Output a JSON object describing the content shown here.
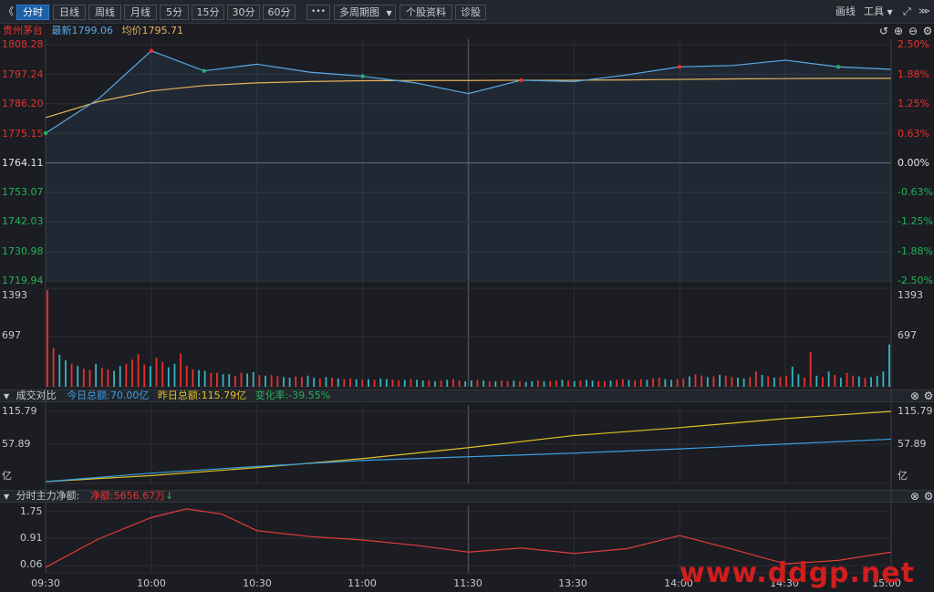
{
  "toolbar": {
    "collapse": "《",
    "periods": [
      "分时",
      "日线",
      "周线",
      "月线",
      "5分",
      "15分",
      "30分",
      "60分"
    ],
    "more": "•••",
    "multi_period": "多周期图",
    "stock_info": "个股资料",
    "diagnose": "诊股",
    "draw_line": "画线",
    "tools": "工具"
  },
  "stock": {
    "name": "贵州茅台",
    "latest_label": "最新",
    "latest": "1799.06",
    "avg_label": "均价",
    "avg": "1795.71"
  },
  "price_axis": {
    "left": [
      "1808.28",
      "1797.24",
      "1786.20",
      "1775.15",
      "1764.11",
      "1753.07",
      "1742.03",
      "1730.98",
      "1719.94"
    ],
    "right": [
      "2.50%",
      "1.88%",
      "1.25%",
      "0.63%",
      "0.00%",
      "-0.63%",
      "-1.25%",
      "-1.88%",
      "-2.50%"
    ]
  },
  "volume_axis": {
    "max": "1393",
    "mid": "697"
  },
  "turnover_panel": {
    "title": "成交对比",
    "today_label": "今日总额:",
    "today": "70.00亿",
    "yesterday_label": "昨日总额:",
    "yesterday": "115.79亿",
    "change_label": "变化率:",
    "change": "-39.55%",
    "axis": [
      "115.79",
      "57.89",
      "亿"
    ]
  },
  "netflow_panel": {
    "title": "分时主力净额:",
    "net_label": "净额:",
    "net": "5656.67万",
    "axis": [
      "1.75",
      "0.91",
      "0.06"
    ]
  },
  "time_axis": [
    "09:30",
    "10:00",
    "10:30",
    "11:00",
    "11:30",
    "13:30",
    "14:00",
    "14:30",
    "15:00"
  ],
  "watermark": "www.ddgp.net",
  "colors": {
    "up": "#e8312f",
    "down": "#21b35b",
    "price_line": "#5aa9e6",
    "avg_line": "#e6b15e",
    "today_line": "#3a9ee3",
    "yesterday_line": "#e2c026",
    "flow_line": "#e23b3b"
  },
  "chart_data": [
    {
      "type": "line",
      "title": "贵州茅台",
      "xlabel": "",
      "ylabel": "",
      "ylim": [
        1719.94,
        1808.28
      ],
      "x": [
        "09:30",
        "09:45",
        "10:00",
        "10:15",
        "10:30",
        "10:45",
        "11:00",
        "11:15",
        "11:30",
        "13:15",
        "13:30",
        "13:45",
        "14:00",
        "14:15",
        "14:30",
        "14:45",
        "15:00"
      ],
      "series": [
        {
          "name": "最新",
          "values": [
            1775.2,
            1788.0,
            1806.0,
            1798.5,
            1801.0,
            1798.0,
            1796.5,
            1794.0,
            1790.0,
            1795.0,
            1794.5,
            1797.0,
            1800.0,
            1800.5,
            1802.5,
            1800.0,
            1799.06
          ]
        },
        {
          "name": "均价",
          "values": [
            1781.0,
            1787.0,
            1791.0,
            1793.0,
            1794.0,
            1794.5,
            1794.8,
            1794.9,
            1794.9,
            1795.0,
            1795.0,
            1795.1,
            1795.3,
            1795.5,
            1795.6,
            1795.7,
            1795.71
          ]
        }
      ]
    },
    {
      "type": "bar",
      "title": "",
      "ylim": [
        0,
        1393
      ],
      "x_range": [
        "09:30",
        "15:00"
      ],
      "values": [
        1393,
        560,
        460,
        380,
        330,
        300,
        260,
        240,
        330,
        270,
        250,
        230,
        300,
        330,
        390,
        470,
        320,
        300,
        420,
        360,
        280,
        330,
        480,
        300,
        250,
        240,
        230,
        200,
        200,
        180,
        180,
        160,
        200,
        190,
        210,
        170,
        160,
        170,
        150,
        140,
        130,
        150,
        140,
        160,
        130,
        120,
        140,
        130,
        120,
        110,
        120,
        110,
        100,
        110,
        100,
        120,
        110,
        100,
        90,
        100,
        110,
        100,
        90,
        90,
        80,
        90,
        100,
        110,
        90,
        80,
        90,
        100,
        90,
        80,
        80,
        90,
        80,
        90,
        80,
        70,
        80,
        90,
        80,
        80,
        90,
        100,
        90,
        80,
        90,
        100,
        90,
        80,
        80,
        90,
        100,
        110,
        100,
        90,
        110,
        100,
        120,
        130,
        110,
        100,
        110,
        120,
        150,
        180,
        160,
        140,
        150,
        170,
        160,
        140,
        130,
        120,
        140,
        220,
        170,
        150,
        130,
        140,
        160,
        290,
        180,
        130,
        500,
        160,
        140,
        220,
        170,
        130,
        200,
        160,
        150,
        130,
        140,
        160,
        220,
        610
      ],
      "up": [
        true,
        true,
        false,
        false,
        true,
        false,
        true,
        true,
        false,
        true,
        true,
        false,
        false,
        true,
        true,
        true,
        true,
        false,
        true,
        true,
        false,
        false,
        true,
        true,
        true,
        false,
        false,
        true,
        true,
        false,
        false,
        true,
        true,
        false,
        false,
        true,
        false,
        true,
        true,
        false,
        false,
        true,
        true,
        false,
        false,
        true,
        false,
        true,
        false,
        true,
        true,
        false,
        true,
        false,
        true,
        false,
        false,
        true,
        true,
        false,
        true,
        false,
        false,
        true,
        false,
        true,
        false,
        true,
        true,
        false,
        false,
        true,
        false,
        true,
        false,
        true,
        true,
        false,
        true,
        false,
        false,
        true,
        false,
        true,
        true,
        false,
        true,
        false,
        true,
        false,
        false,
        true,
        true,
        false,
        true,
        true,
        false,
        true,
        true,
        false,
        true,
        true,
        false,
        false,
        true,
        true,
        false,
        true,
        true,
        false,
        true,
        false,
        true,
        true,
        false,
        false,
        true,
        true,
        false,
        true,
        false,
        true,
        true,
        false,
        false,
        true,
        true,
        false,
        true,
        false,
        true,
        false,
        true,
        true,
        false,
        true,
        false,
        false,
        false,
        false
      ]
    },
    {
      "type": "line",
      "title": "成交对比",
      "ylim": [
        0,
        115.79
      ],
      "x": [
        "09:30",
        "10:00",
        "10:30",
        "11:00",
        "11:30",
        "13:30",
        "14:00",
        "14:30",
        "15:00"
      ],
      "series": [
        {
          "name": "今日总额",
          "values": [
            0,
            14,
            25,
            35,
            41,
            47,
            54,
            62,
            70
          ]
        },
        {
          "name": "昨日总额",
          "values": [
            0,
            10,
            23,
            38,
            56,
            76,
            89,
            104,
            115.79
          ]
        }
      ]
    },
    {
      "type": "line",
      "title": "分时主力净额",
      "ylim": [
        -0.1,
        1.8
      ],
      "x": [
        "09:30",
        "09:45",
        "10:00",
        "10:10",
        "10:20",
        "10:30",
        "10:45",
        "11:00",
        "11:15",
        "11:30",
        "13:15",
        "13:30",
        "13:45",
        "14:00",
        "14:15",
        "14:30",
        "14:45",
        "15:00"
      ],
      "series": [
        {
          "name": "净额",
          "values": [
            0.06,
            0.88,
            1.5,
            1.75,
            1.6,
            1.12,
            0.95,
            0.85,
            0.7,
            0.5,
            0.62,
            0.46,
            0.6,
            0.98,
            0.58,
            0.16,
            0.26,
            0.5
          ]
        }
      ]
    }
  ]
}
